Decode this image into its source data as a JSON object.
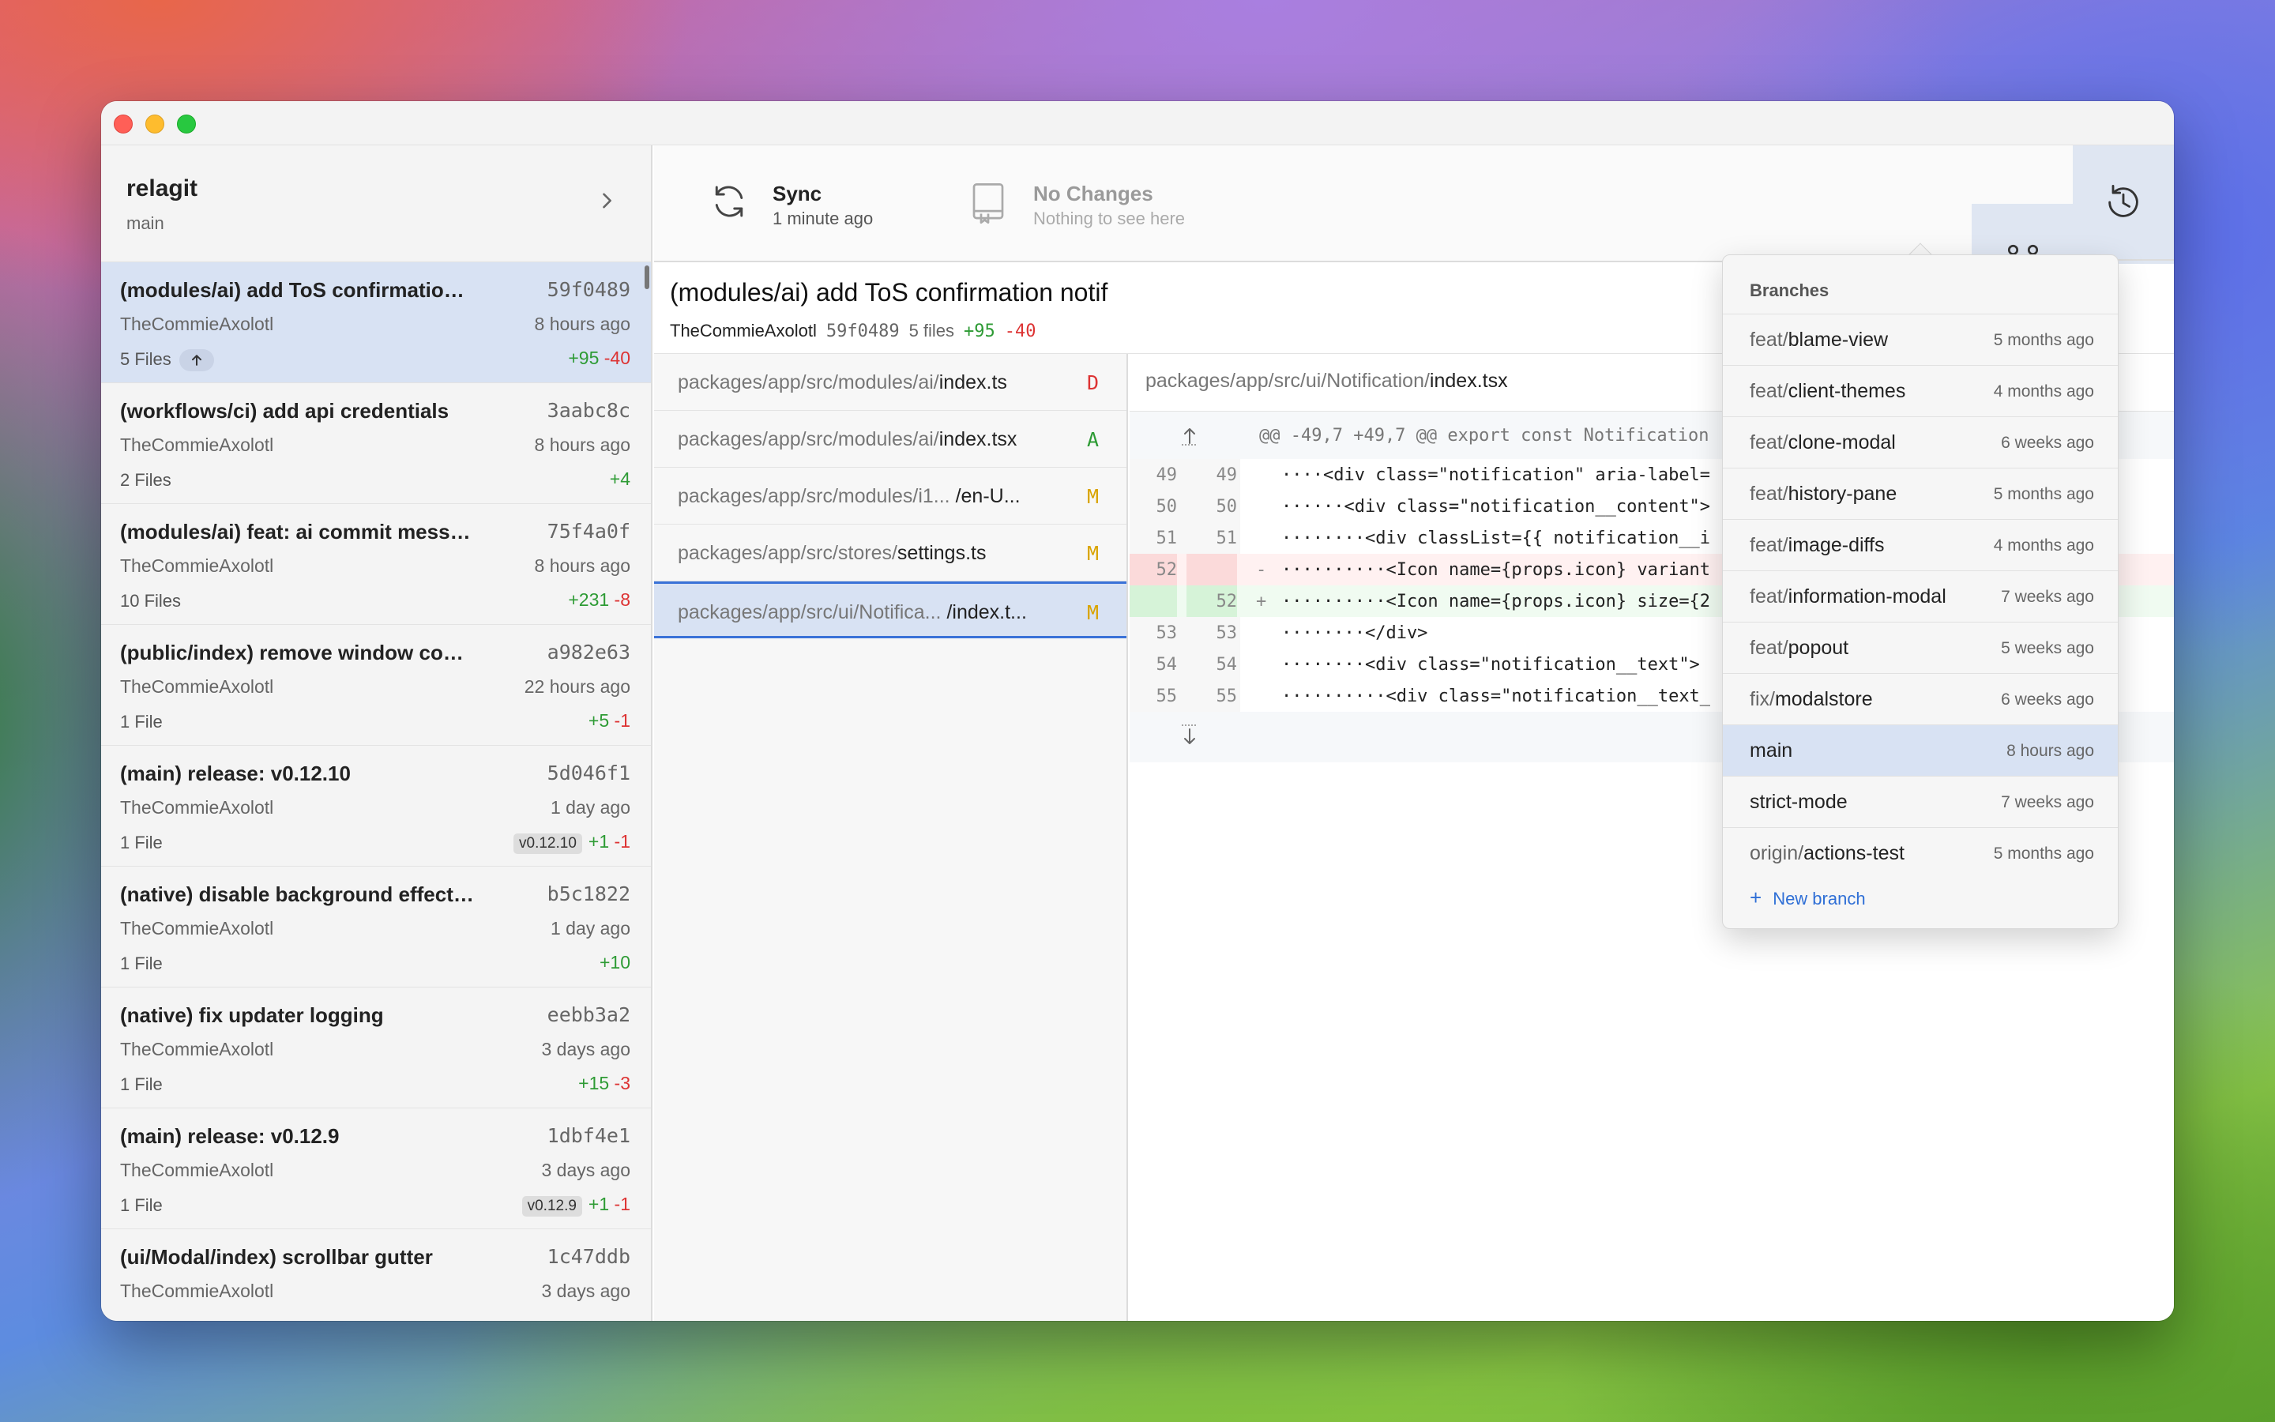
{
  "sidebar": {
    "repo_name": "relagit",
    "repo_branch": "main",
    "commits": [
      {
        "title": "(modules/ai) add ToS confirmation ...",
        "hash": "59f0489",
        "author": "TheCommieAxolotl",
        "time": "8 hours ago",
        "files": "5 Files",
        "add": "+95",
        "del": "-40",
        "tag": "",
        "active": true,
        "push": true
      },
      {
        "title": "(workflows/ci) add api credentials",
        "hash": "3aabc8c",
        "author": "TheCommieAxolotl",
        "time": "8 hours ago",
        "files": "2 Files",
        "add": "+4",
        "del": "",
        "tag": ""
      },
      {
        "title": "(modules/ai) feat: ai commit messa...",
        "hash": "75f4a0f",
        "author": "TheCommieAxolotl",
        "time": "8 hours ago",
        "files": "10 Files",
        "add": "+231",
        "del": "-8",
        "tag": ""
      },
      {
        "title": "(public/index) remove window cont...",
        "hash": "a982e63",
        "author": "TheCommieAxolotl",
        "time": "22 hours ago",
        "files": "1 File",
        "add": "+5",
        "del": "-1",
        "tag": ""
      },
      {
        "title": "(main) release: v0.12.10",
        "hash": "5d046f1",
        "author": "TheCommieAxolotl",
        "time": "1 day ago",
        "files": "1 File",
        "add": "+1",
        "del": "-1",
        "tag": "v0.12.10"
      },
      {
        "title": "(native) disable background effects...",
        "hash": "b5c1822",
        "author": "TheCommieAxolotl",
        "time": "1 day ago",
        "files": "1 File",
        "add": "+10",
        "del": "",
        "tag": ""
      },
      {
        "title": "(native) fix updater logging",
        "hash": "eebb3a2",
        "author": "TheCommieAxolotl",
        "time": "3 days ago",
        "files": "1 File",
        "add": "+15",
        "del": "-3",
        "tag": ""
      },
      {
        "title": "(main) release: v0.12.9",
        "hash": "1dbf4e1",
        "author": "TheCommieAxolotl",
        "time": "3 days ago",
        "files": "1 File",
        "add": "+1",
        "del": "-1",
        "tag": "v0.12.9"
      },
      {
        "title": "(ui/Modal/index) scrollbar gutter",
        "hash": "1c47ddb",
        "author": "TheCommieAxolotl",
        "time": "3 days ago",
        "files": "",
        "add": "",
        "del": "",
        "tag": ""
      }
    ]
  },
  "toolbar": {
    "sync_title": "Sync",
    "sync_sub": "1 minute ago",
    "status_title": "No Changes",
    "status_sub": "Nothing to see here"
  },
  "commit_header": {
    "title": "(modules/ai) add ToS confirmation notif",
    "author": "TheCommieAxolotl",
    "hash": "59f0489",
    "files": "5 files",
    "add": "+95",
    "del": "-40"
  },
  "files": [
    {
      "dir": "packages/app/src/modules/ai/",
      "name": "index.ts",
      "status": "D"
    },
    {
      "dir": "packages/app/src/modules/ai/",
      "name": "index.tsx",
      "status": "A"
    },
    {
      "dir": "packages/app/src/modules/i1... ",
      "name": "/en-U...",
      "status": "M"
    },
    {
      "dir": "packages/app/src/stores/",
      "name": "settings.ts",
      "status": "M"
    },
    {
      "dir": "packages/app/src/ui/Notifica... ",
      "name": "/index.t...",
      "status": "M",
      "active": true
    }
  ],
  "diff": {
    "path_dir": "packages/app/src/ui/Notification/",
    "path_name": "index.tsx",
    "hunk_header": "@@ -49,7 +49,7 @@ export const Notification",
    "lines": [
      {
        "old": "49",
        "new": "49",
        "mark": "",
        "code": "····<div class=\"notification\" aria-label=",
        "type": "ctx"
      },
      {
        "old": "50",
        "new": "50",
        "mark": "",
        "code": "······<div class=\"notification__content\">",
        "type": "ctx"
      },
      {
        "old": "51",
        "new": "51",
        "mark": "",
        "code": "········<div classList={{ notification__i",
        "type": "ctx"
      },
      {
        "old": "52",
        "new": "",
        "mark": "-",
        "code": "··········<Icon name={props.icon} variant",
        "type": "del"
      },
      {
        "old": "",
        "new": "52",
        "mark": "+",
        "code": "··········<Icon name={props.icon} size={2",
        "type": "add"
      },
      {
        "old": "53",
        "new": "53",
        "mark": "",
        "code": "········</div>",
        "type": "ctx"
      },
      {
        "old": "54",
        "new": "54",
        "mark": "",
        "code": "········<div class=\"notification__text\">",
        "type": "ctx"
      },
      {
        "old": "55",
        "new": "55",
        "mark": "",
        "code": "··········<div class=\"notification__text_",
        "type": "ctx"
      }
    ]
  },
  "branches_popover": {
    "title": "Branches",
    "items": [
      {
        "prefix": "feat/",
        "name": "blame-view",
        "time": "5 months ago"
      },
      {
        "prefix": "feat/",
        "name": "client-themes",
        "time": "4 months ago"
      },
      {
        "prefix": "feat/",
        "name": "clone-modal",
        "time": "6 weeks ago"
      },
      {
        "prefix": "feat/",
        "name": "history-pane",
        "time": "5 months ago"
      },
      {
        "prefix": "feat/",
        "name": "image-diffs",
        "time": "4 months ago"
      },
      {
        "prefix": "feat/",
        "name": "information-modal",
        "time": "7 weeks ago"
      },
      {
        "prefix": "feat/",
        "name": "popout",
        "time": "5 weeks ago"
      },
      {
        "prefix": "fix/",
        "name": "modalstore",
        "time": "6 weeks ago"
      },
      {
        "prefix": "",
        "name": "main",
        "time": "8 hours ago",
        "current": true
      },
      {
        "prefix": "",
        "name": "strict-mode",
        "time": "7 weeks ago"
      },
      {
        "prefix": "origin/",
        "name": "actions-test",
        "time": "5 months ago"
      }
    ],
    "new_branch_label": "New branch"
  },
  "colors": {
    "accent": "#3a72d8",
    "added": "#2e9b35",
    "deleted": "#d33333",
    "modified": "#d9a400",
    "selection": "#d8e2f3"
  },
  "icons": {
    "sync": "sync-icon",
    "repo": "repo-icon",
    "branches": "branch-icon",
    "people": "people-icon",
    "history": "history-icon"
  }
}
